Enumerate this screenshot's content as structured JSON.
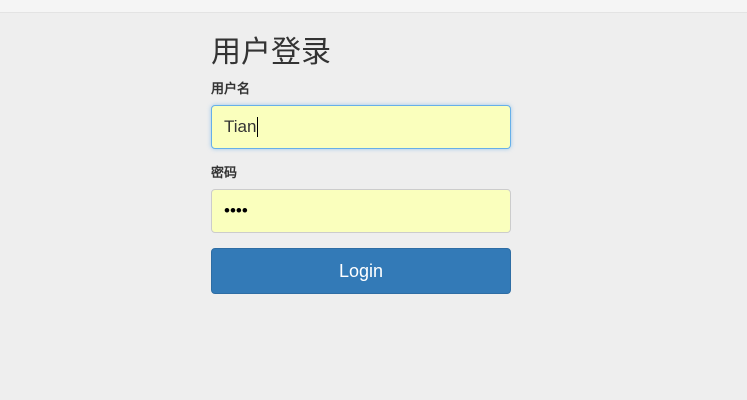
{
  "form": {
    "title": "用户登录",
    "username_label": "用户名",
    "username_value": "Tian",
    "password_label": "密码",
    "password_masked": "••••",
    "submit_label": "Login"
  },
  "colors": {
    "background": "#eeeeee",
    "autofill": "#faffbd",
    "primary_button": "#337ab7",
    "focus_border": "#66afe9"
  }
}
